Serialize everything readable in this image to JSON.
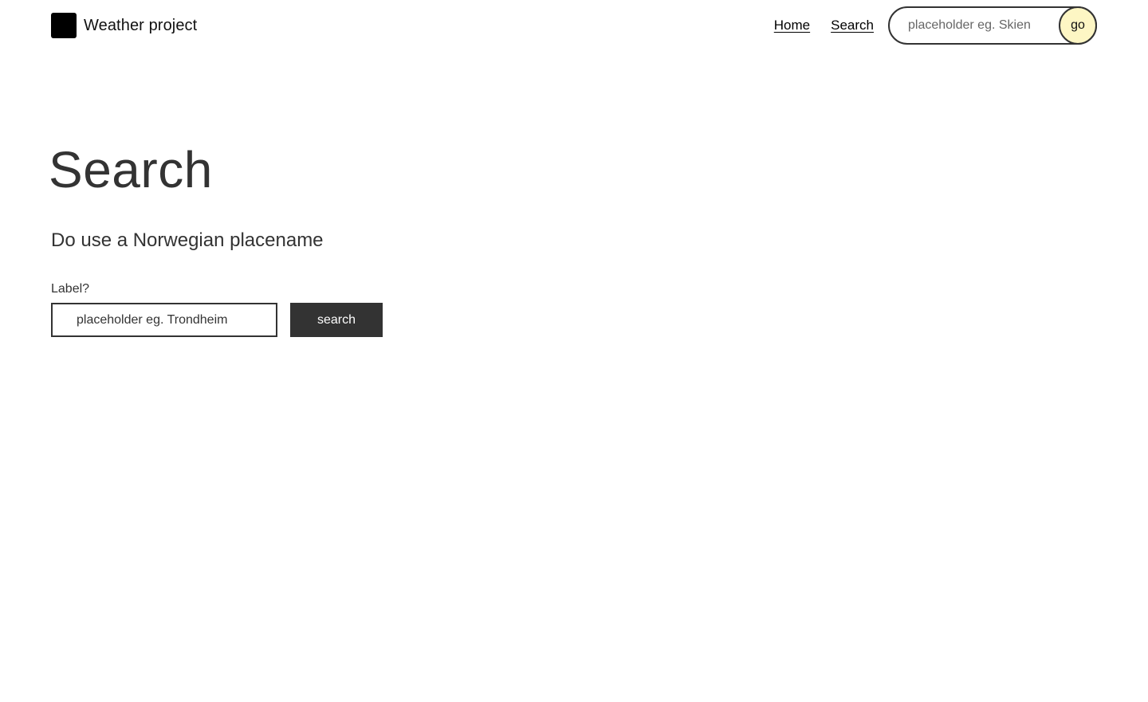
{
  "header": {
    "brand_name": "Weather project",
    "logo_icon": "square-logo-icon",
    "nav": {
      "home_label": "Home",
      "search_label": "Search"
    },
    "mini_search": {
      "placeholder": "placeholder eg. Skien",
      "value": "",
      "go_label": "go",
      "go_color": "#fdf6c4"
    }
  },
  "main": {
    "title": "Search",
    "subtitle": "Do use a Norwegian placename",
    "form": {
      "label": "Label?",
      "placeholder": "placeholder eg. Trondheim",
      "value": "",
      "button_label": "search",
      "button_color": "#333333"
    }
  }
}
